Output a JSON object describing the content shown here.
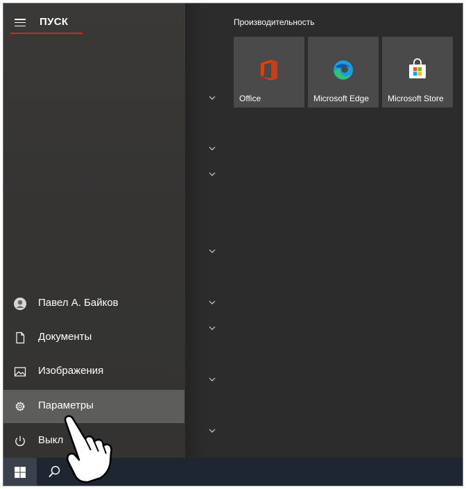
{
  "start_menu": {
    "title": "ПУСК",
    "menu_icon": "hamburger-menu-icon",
    "nav": [
      {
        "label": "Павел А. Байков",
        "icon": "user-avatar-icon"
      },
      {
        "label": "Документы",
        "icon": "document-icon"
      },
      {
        "label": "Изображения",
        "icon": "pictures-icon"
      },
      {
        "label": "Параметры",
        "icon": "gear-icon",
        "selected": true
      },
      {
        "label": "Выкл",
        "icon": "power-icon"
      }
    ]
  },
  "tiles_group": {
    "title": "Производительность",
    "tiles": [
      {
        "label": "Office",
        "icon": "office-icon"
      },
      {
        "label": "Microsoft Edge",
        "icon": "edge-icon"
      },
      {
        "label": "Microsoft Store",
        "icon": "store-icon"
      }
    ]
  },
  "taskbar": {
    "items": [
      {
        "icon": "windows-start-icon"
      },
      {
        "icon": "search-icon"
      },
      {
        "icon": "file-explorer-icon"
      }
    ]
  },
  "colors": {
    "accent_underline": "#e02020",
    "tile_bg": "#4a4a4a",
    "selected_item_bg": "#5d5d5c",
    "taskbar_bg": "#1e2632"
  }
}
